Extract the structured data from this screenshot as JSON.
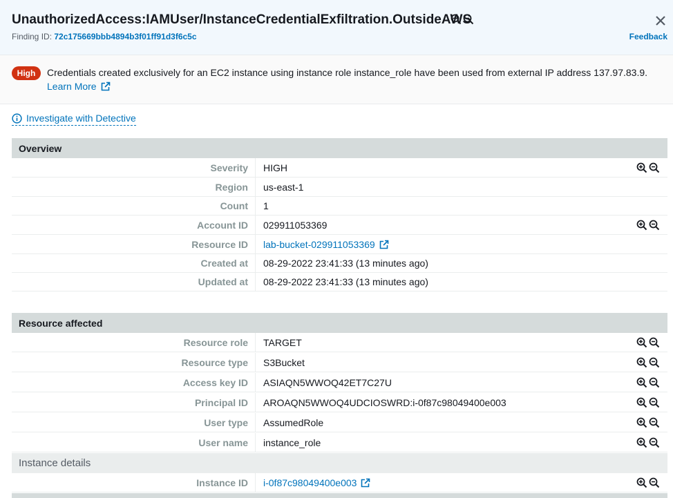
{
  "header": {
    "title": "UnauthorizedAccess:IAMUser/InstanceCredentialExfiltration.OutsideAWS",
    "finding_id_label": "Finding ID:",
    "finding_id": "72c175669bbb4894b3f01ff91d3f6c5c",
    "feedback": "Feedback"
  },
  "description": {
    "severity_badge": "High",
    "text": "Credentials created exclusively for an EC2 instance using instance role instance_role have been used from external IP address 137.97.83.9.",
    "learn_more": "Learn More"
  },
  "detective_link": "Investigate with Detective",
  "overview": {
    "title": "Overview",
    "rows": [
      {
        "label": "Severity",
        "value": "HIGH"
      },
      {
        "label": "Region",
        "value": "us-east-1"
      },
      {
        "label": "Count",
        "value": "1"
      },
      {
        "label": "Account ID",
        "value": "029911053369"
      },
      {
        "label": "Resource ID",
        "value": "lab-bucket-029911053369"
      },
      {
        "label": "Created at",
        "value": "08-29-2022 23:41:33 (13 minutes ago)"
      },
      {
        "label": "Updated at",
        "value": "08-29-2022 23:41:33 (13 minutes ago)"
      }
    ]
  },
  "resource_affected": {
    "title": "Resource affected",
    "rows": [
      {
        "label": "Resource role",
        "value": "TARGET"
      },
      {
        "label": "Resource type",
        "value": "S3Bucket"
      },
      {
        "label": "Access key ID",
        "value": "ASIAQN5WWOQ42ET7C27U"
      },
      {
        "label": "Principal ID",
        "value": "AROAQN5WWOQ4UDCIOSWRD:i-0f87c98049400e003"
      },
      {
        "label": "User type",
        "value": "AssumedRole"
      },
      {
        "label": "User name",
        "value": "instance_role"
      }
    ]
  },
  "instance_details": {
    "title": "Instance details",
    "rows": [
      {
        "label": "Instance ID",
        "value": "i-0f87c98049400e003"
      }
    ]
  },
  "colors": {
    "link": "#0073bb",
    "high": "#d13212",
    "section_header": "#d5dbdb"
  }
}
